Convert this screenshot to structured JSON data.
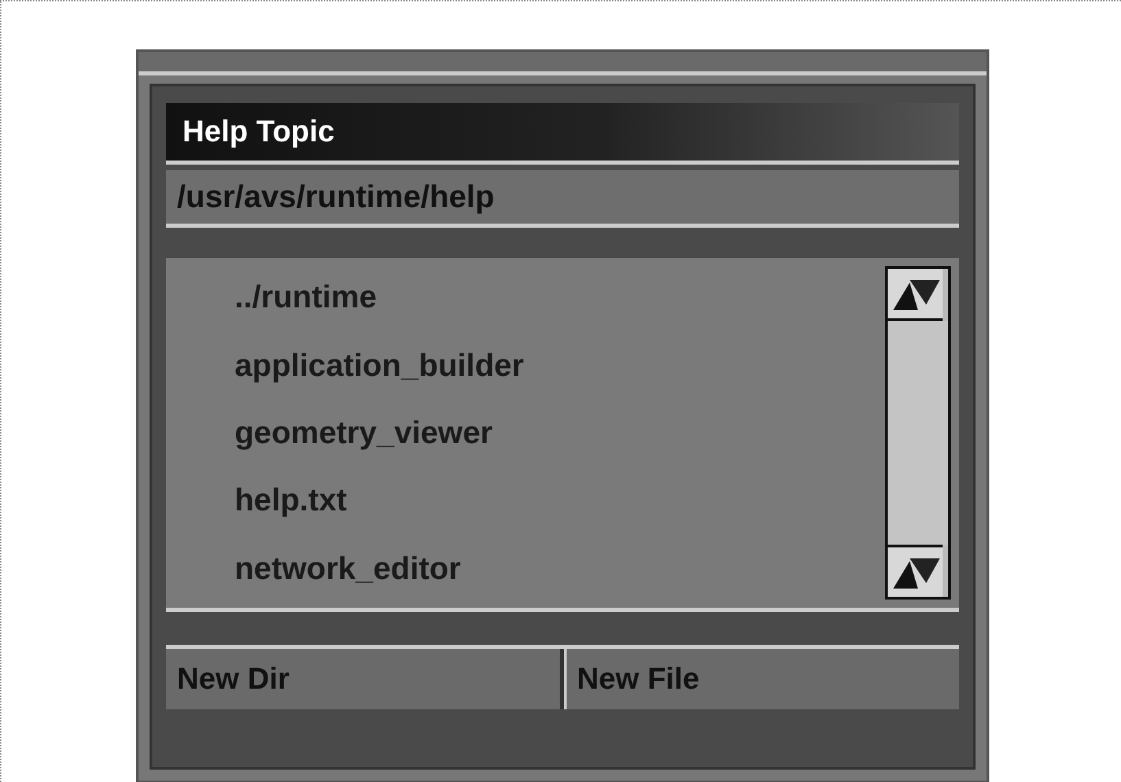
{
  "window": {
    "title": "Help Topic"
  },
  "path_field": {
    "value": "/usr/avs/runtime/help"
  },
  "file_list": {
    "items": [
      {
        "label": "../runtime"
      },
      {
        "label": "application_builder"
      },
      {
        "label": "geometry_viewer"
      },
      {
        "label": "help.txt"
      },
      {
        "label": "network_editor"
      }
    ]
  },
  "buttons": [
    "New Dir",
    "New File"
  ]
}
